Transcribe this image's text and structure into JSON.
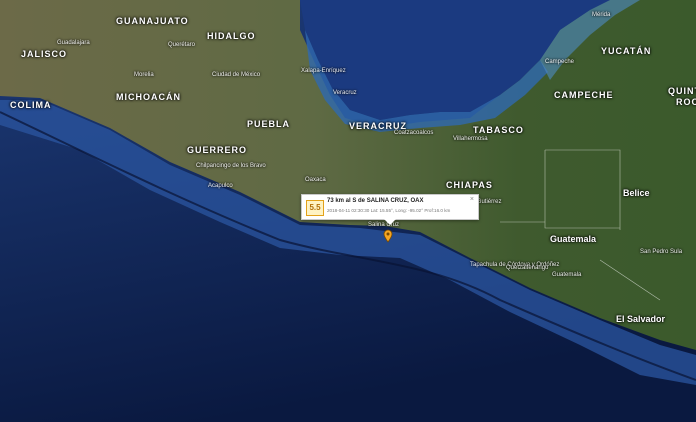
{
  "states": [
    {
      "id": "guanajuato",
      "label": "GUANAJUATO"
    },
    {
      "id": "hidalgo",
      "label": "HIDALGO"
    },
    {
      "id": "jalisco",
      "label": "JALISCO"
    },
    {
      "id": "michoacan",
      "label": "MICHOACÁN"
    },
    {
      "id": "colima",
      "label": "COLIMA"
    },
    {
      "id": "puebla",
      "label": "PUEBLA"
    },
    {
      "id": "guerrero",
      "label": "GUERRERO"
    },
    {
      "id": "veracruz",
      "label": "VERACRUZ"
    },
    {
      "id": "tabasco",
      "label": "TABASCO"
    },
    {
      "id": "chiapas",
      "label": "CHIAPAS"
    },
    {
      "id": "campeche",
      "label": "CAMPECHE"
    },
    {
      "id": "yucatan",
      "label": "YUCATÁN"
    },
    {
      "id": "quintana",
      "label": "QUINT"
    },
    {
      "id": "quintana-roo",
      "label": "ROO"
    }
  ],
  "countries": [
    {
      "id": "guatemala",
      "label": "Guatemala"
    },
    {
      "id": "belice",
      "label": "Belice"
    },
    {
      "id": "el-salvador",
      "label": "El Salvador"
    }
  ],
  "cities": [
    {
      "id": "guadalajara",
      "label": "Guadalajara"
    },
    {
      "id": "ciudad-mexico",
      "label": "Ciudad de México"
    },
    {
      "id": "queretaro",
      "label": "Querétaro"
    },
    {
      "id": "morelia",
      "label": "Morelia"
    },
    {
      "id": "chilpancingo",
      "label": "Chilpancingo de los Bravo"
    },
    {
      "id": "acapulco",
      "label": "Acapulco"
    },
    {
      "id": "xalapa",
      "label": "Xalapa-Enríquez"
    },
    {
      "id": "veracruz-city",
      "label": "Veracruz"
    },
    {
      "id": "coatzacoalcos",
      "label": "Coatzacoalcos"
    },
    {
      "id": "villahermosa",
      "label": "Villahermosa"
    },
    {
      "id": "campeche-city",
      "label": "Campeche"
    },
    {
      "id": "merida",
      "label": "Mérida"
    },
    {
      "id": "tuxtla",
      "label": "Tuxtla Gutiérrez"
    },
    {
      "id": "tapachula",
      "label": "Tapachula de Córdova y Ordóñez"
    },
    {
      "id": "quetzaltenango",
      "label": "Quetzaltenango"
    },
    {
      "id": "guatemala-city",
      "label": "Guatemala"
    },
    {
      "id": "san-pedro-sula",
      "label": "San Pedro Sula"
    },
    {
      "id": "salina-cruz",
      "label": "Salina Cruz"
    },
    {
      "id": "oaxaca",
      "label": "Oaxaca"
    }
  ],
  "popup": {
    "magnitude": "5.5",
    "title": "73 km al S de SALINA CRUZ, OAX",
    "detail": "2018-04-11   02:30:30   Lat: 15.55°, Long: -95.02°   Prof:16.0 km",
    "close": "×"
  },
  "colors": {
    "ocean_deep": "#0d1f4a",
    "ocean_shelf": "#2c58a6",
    "gulf": "#1c3d85",
    "land": "#5e6b44",
    "marker": "#f5a623"
  }
}
